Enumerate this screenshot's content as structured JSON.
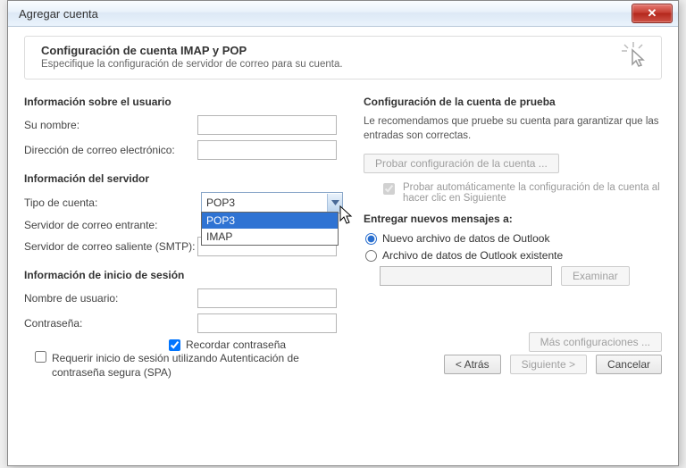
{
  "window": {
    "title": "Agregar cuenta"
  },
  "header": {
    "title": "Configuración de cuenta IMAP y POP",
    "subtitle": "Especifique la configuración de servidor de correo para su cuenta."
  },
  "sections": {
    "user_info": "Información sobre el usuario",
    "server_info": "Información del servidor",
    "login_info": "Información de inicio de sesión"
  },
  "labels": {
    "name": "Su nombre:",
    "email": "Dirección de correo electrónico:",
    "account_type": "Tipo de cuenta:",
    "incoming": "Servidor de correo entrante:",
    "outgoing": "Servidor de correo saliente (SMTP):",
    "username": "Nombre de usuario:",
    "password": "Contraseña:",
    "remember": "Recordar contraseña",
    "spa": "Requerir inicio de sesión utilizando Autenticación de contraseña segura (SPA)"
  },
  "account_type": {
    "selected": "POP3",
    "options": [
      "POP3",
      "IMAP"
    ]
  },
  "fields": {
    "name": "",
    "email": "",
    "incoming": "",
    "outgoing": "",
    "username": "",
    "password": "",
    "remember_checked": true,
    "spa_checked": false,
    "path": ""
  },
  "test": {
    "title": "Configuración de la cuenta de prueba",
    "desc": "Le recomendamos que pruebe su cuenta para garantizar que las entradas son correctas.",
    "button": "Probar configuración de la cuenta ...",
    "auto": "Probar automáticamente la configuración de la cuenta al hacer clic en Siguiente"
  },
  "deliver": {
    "title": "Entregar nuevos mensajes a:",
    "opt_new": "Nuevo archivo de datos de Outlook",
    "opt_existing": "Archivo de datos de Outlook existente",
    "browse": "Examinar"
  },
  "buttons": {
    "more": "Más configuraciones ...",
    "back": "< Atrás",
    "next": "Siguiente >",
    "cancel": "Cancelar"
  }
}
